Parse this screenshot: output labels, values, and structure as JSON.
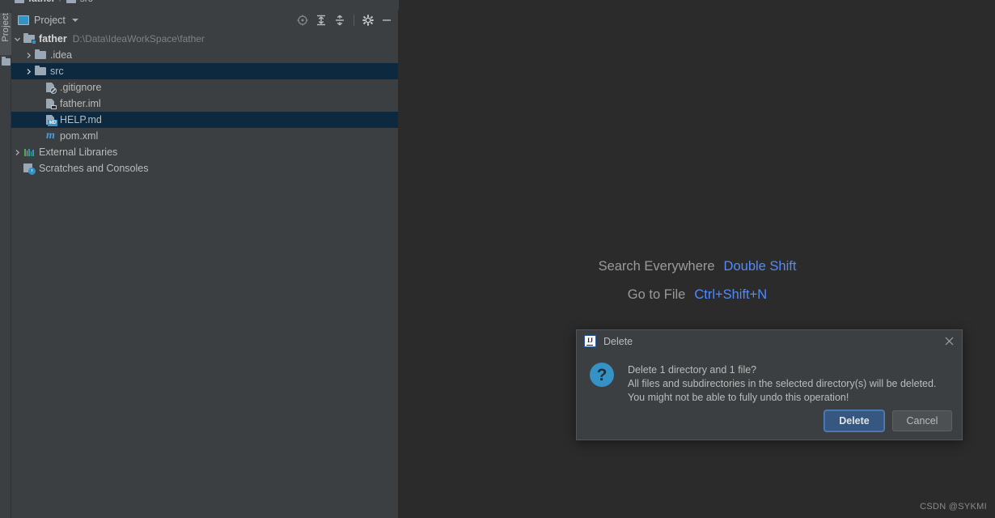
{
  "breadcrumb": {
    "segments": [
      "father",
      "src"
    ],
    "separator": "/"
  },
  "tool_strip": {
    "tab_label": "Project"
  },
  "project_panel": {
    "title": "Project",
    "actions": [
      {
        "name": "select-opened-file",
        "icon": "crosshair-target-icon",
        "tooltip": "Select Opened File"
      },
      {
        "name": "expand-all",
        "icon": "expand-all-icon",
        "tooltip": "Expand All"
      },
      {
        "name": "collapse-all",
        "icon": "collapse-all-icon",
        "tooltip": "Collapse All"
      },
      {
        "name": "settings",
        "icon": "gear-icon",
        "tooltip": "Settings"
      },
      {
        "name": "hide",
        "icon": "minimize-icon",
        "tooltip": "Hide"
      }
    ],
    "tree": [
      {
        "label": "father",
        "sub": "D:\\Data\\IdeaWorkSpace\\father",
        "icon": "module-folder-icon",
        "indent": 0,
        "arrow": "expanded",
        "bold": true,
        "selected": false
      },
      {
        "label": ".idea",
        "sub": "",
        "icon": "folder-icon",
        "indent": 1,
        "arrow": "collapsed",
        "bold": false,
        "selected": false
      },
      {
        "label": "src",
        "sub": "",
        "icon": "folder-icon",
        "indent": 1,
        "arrow": "collapsed",
        "bold": false,
        "selected": true
      },
      {
        "label": ".gitignore",
        "sub": "",
        "icon": "gitignore-file-icon",
        "indent": 2,
        "arrow": "none",
        "bold": false,
        "selected": false
      },
      {
        "label": "father.iml",
        "sub": "",
        "icon": "iml-file-icon",
        "indent": 2,
        "arrow": "none",
        "bold": false,
        "selected": false
      },
      {
        "label": "HELP.md",
        "sub": "",
        "icon": "markdown-file-icon",
        "indent": 2,
        "arrow": "none",
        "bold": false,
        "selected": true
      },
      {
        "label": "pom.xml",
        "sub": "",
        "icon": "maven-file-icon",
        "indent": 2,
        "arrow": "none",
        "bold": false,
        "selected": false
      },
      {
        "label": "External Libraries",
        "sub": "",
        "icon": "libraries-icon",
        "indent": 0,
        "arrow": "collapsed",
        "bold": false,
        "selected": false
      },
      {
        "label": "Scratches and Consoles",
        "sub": "",
        "icon": "scratches-icon",
        "indent": 0,
        "arrow": "none",
        "bold": false,
        "selected": false
      }
    ]
  },
  "editor": {
    "hints": [
      {
        "text": "Search Everywhere",
        "key": "Double Shift"
      },
      {
        "text": "Go to File",
        "key": "Ctrl+Shift+N"
      }
    ],
    "watermark": "CSDN @SYKMI"
  },
  "dialog": {
    "title": "Delete",
    "icon": "intellij-idea-logo-icon",
    "logo_text": "IJ",
    "close_icon": "close-icon",
    "question_icon": "question-mark-icon",
    "question_glyph": "?",
    "message_lines": [
      "Delete 1 directory and 1 file?",
      "All files and subdirectories in the selected directory(s) will be deleted.",
      "You might not be able to fully undo this operation!"
    ],
    "buttons": [
      {
        "label": "Delete",
        "style": "default"
      },
      {
        "label": "Cancel",
        "style": "plain"
      }
    ]
  },
  "colors": {
    "panel_bg": "#3c3f41",
    "editor_bg": "#2b2b2b",
    "selection_bg": "#0d293f",
    "accent_blue": "#3592c4",
    "key_hint_blue": "#548af7",
    "default_button_bg": "#365880",
    "text": "#bbbbbb"
  }
}
